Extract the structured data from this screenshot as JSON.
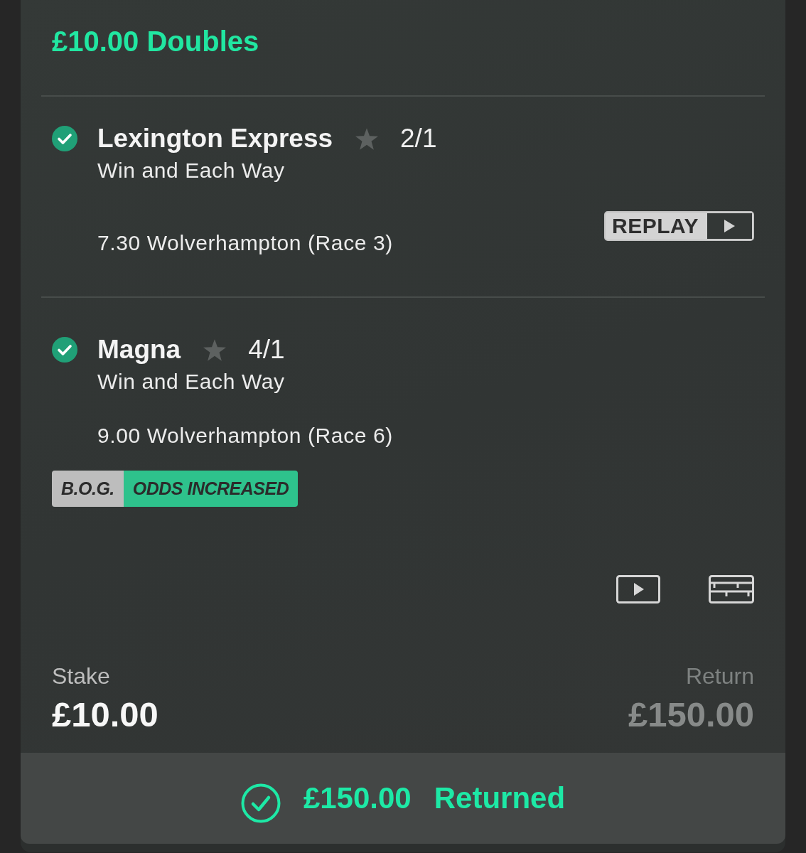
{
  "bet": {
    "title": "£10.00 Doubles"
  },
  "selections": [
    {
      "name": "Lexington Express",
      "won": true,
      "favourite": false,
      "odds": "2/1",
      "market": "Win and Each Way",
      "event": "7.30 Wolverhampton (Race 3)",
      "replay": "REPLAY"
    },
    {
      "name": "Magna",
      "won": true,
      "favourite": false,
      "odds": "4/1",
      "market": "Win and Each Way",
      "event": "9.00 Wolverhampton (Race 6)",
      "tags": [
        {
          "label": "B.O.G.",
          "color": "#bdbdbd"
        },
        {
          "label": "ODDS INCREASED",
          "color": "#2ec28c"
        }
      ]
    }
  ],
  "stake": {
    "label": "Stake",
    "value": "£10.00"
  },
  "potential_return": {
    "label": "Return",
    "value": "£150.00"
  },
  "result": {
    "amount": "£150.00",
    "status": "Returned"
  }
}
